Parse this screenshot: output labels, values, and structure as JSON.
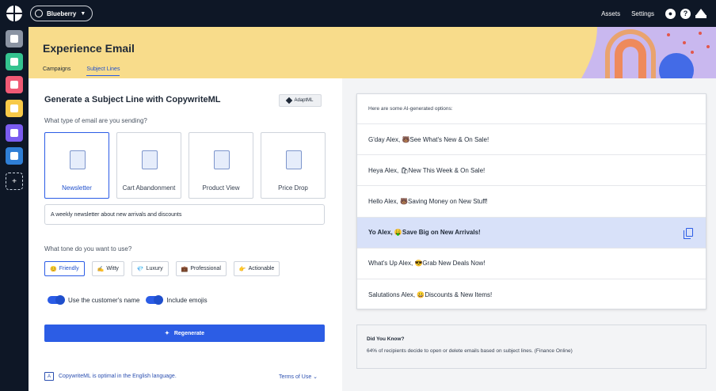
{
  "topbar": {
    "workspace": "Blueberry",
    "assets": "Assets",
    "settings": "Settings",
    "icons": [
      "logo-icon",
      "globe-icon",
      "user-icon",
      "help-icon",
      "crown-icon"
    ]
  },
  "sidebar": {
    "items": [
      {
        "name": "dashboard",
        "color": "#8b94a3"
      },
      {
        "name": "audience",
        "color": "#34c38f"
      },
      {
        "name": "templates",
        "color": "#f05a75"
      },
      {
        "name": "email",
        "color": "#f7c948"
      },
      {
        "name": "automations",
        "color": "#7a5cf0"
      },
      {
        "name": "layers",
        "color": "#2f7fd6"
      }
    ],
    "add": "+"
  },
  "header": {
    "title": "Experience Email",
    "tabs": [
      {
        "label": "Campaigns",
        "active": false
      },
      {
        "label": "Subject Lines",
        "active": true
      }
    ]
  },
  "left": {
    "title": "Generate a Subject Line with CopywriteML",
    "badge": "AdaptML",
    "type_question": "What type of email are you sending?",
    "types": [
      {
        "label": "Newsletter",
        "selected": true
      },
      {
        "label": "Cart Abandonment",
        "selected": false
      },
      {
        "label": "Product View",
        "selected": false
      },
      {
        "label": "Price Drop",
        "selected": false
      }
    ],
    "description": "A weekly newsletter about new arrivals and discounts",
    "tone_question": "What tone do you want to use?",
    "tones": [
      {
        "emoji": "😊",
        "label": "Friendly",
        "selected": true
      },
      {
        "emoji": "✍",
        "label": "Witty",
        "selected": false
      },
      {
        "emoji": "💎",
        "label": "Luxury",
        "selected": false
      },
      {
        "emoji": "💼",
        "label": "Professional",
        "selected": false
      },
      {
        "emoji": "👉",
        "label": "Actionable",
        "selected": false
      }
    ],
    "toggle_name": "Use the customer's name",
    "toggle_emoji": "Include emojis",
    "regenerate": "Regenerate",
    "note": "CopywriteML is optimal in the English language.",
    "terms": "Terms of Use ⌄"
  },
  "options": {
    "heading": "Here are some AI-generated options:",
    "items": [
      {
        "text": "G'day Alex, 🐻See What's New & On Sale!",
        "selected": false
      },
      {
        "text": "Heya Alex, 🛍New This Week & On Sale!",
        "selected": false
      },
      {
        "text": "Hello Alex, 🐻Saving Money on New Stuff!",
        "selected": false
      },
      {
        "text": "Yo Alex, 🤑Save Big on New Arrivals!",
        "selected": true
      },
      {
        "text": "What's Up Alex, 😎Grab New Deals Now!",
        "selected": false
      },
      {
        "text": "Salutations Alex, 😀Discounts & New Items!",
        "selected": false
      }
    ]
  },
  "dyk": {
    "title": "Did You Know?",
    "body": "64% of recipients decide to open or delete emails based on subject lines. (Finance Online)"
  }
}
